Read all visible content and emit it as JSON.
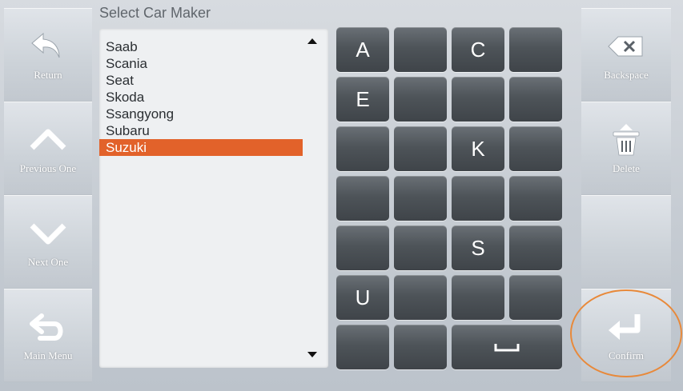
{
  "header": {
    "title": "Select Car Maker"
  },
  "left_nav": [
    {
      "label": "Return",
      "icon": "return-arrow-icon"
    },
    {
      "label": "Previous One",
      "icon": "chevron-up-icon"
    },
    {
      "label": "Next One",
      "icon": "chevron-down-icon"
    },
    {
      "label": "Main Menu",
      "icon": "main-menu-arrow-icon"
    }
  ],
  "right_nav": {
    "backspace": {
      "label": "Backspace",
      "icon": "backspace-icon"
    },
    "delete": {
      "label": "Delete",
      "icon": "trash-icon"
    },
    "confirm": {
      "label": "Confirm",
      "icon": "enter-arrow-icon"
    }
  },
  "list": {
    "items": [
      "Saab",
      "Scania",
      "Seat",
      "Skoda",
      "Ssangyong",
      "Subaru",
      "Suzuki"
    ],
    "selected_index": 6
  },
  "keypad": {
    "rows": [
      [
        "A",
        "",
        "C",
        ""
      ],
      [
        "E",
        "",
        "",
        ""
      ],
      [
        "",
        "",
        "K",
        ""
      ],
      [
        "",
        "",
        "",
        ""
      ],
      [
        "",
        "",
        "S",
        ""
      ],
      [
        "U",
        "",
        "",
        ""
      ]
    ],
    "space_label": "␣"
  },
  "colors": {
    "selection": "#e2622a",
    "key": "#4e5459",
    "highlight_ring": "#e8893a",
    "background": "#c9ced4"
  }
}
